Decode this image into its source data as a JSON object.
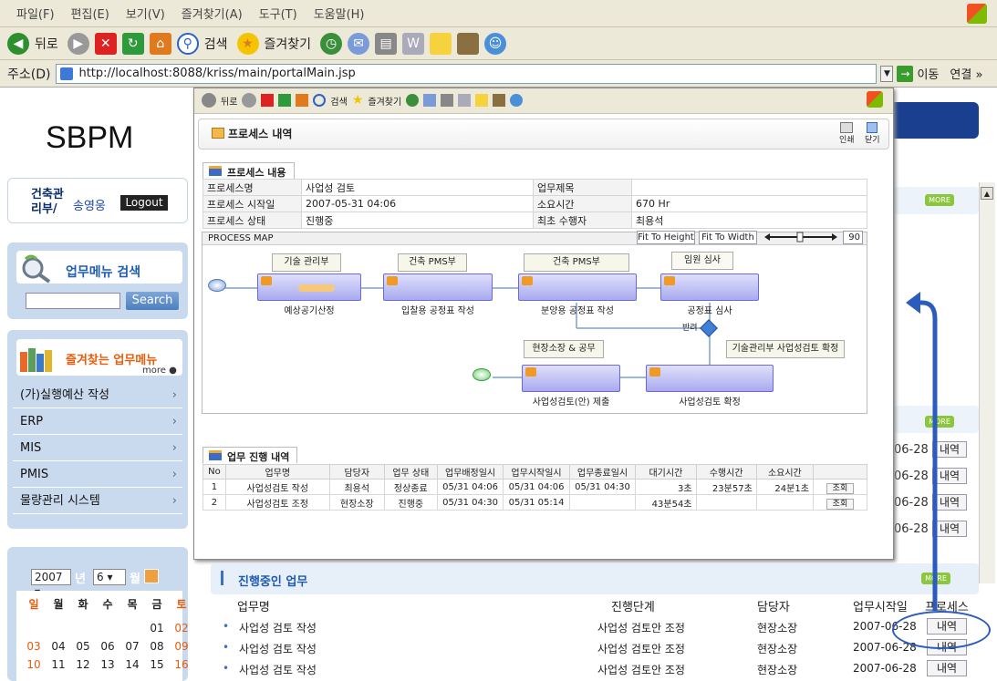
{
  "browser": {
    "menu": [
      "파일(F)",
      "편집(E)",
      "보기(V)",
      "즐겨찾기(A)",
      "도구(T)",
      "도움말(H)"
    ],
    "back_label": "뒤로",
    "search_label": "검색",
    "favorites_label": "즐겨찾기",
    "address_label": "주소(D)",
    "url": "http://localhost:8088/kriss/main/portalMain.jsp",
    "go_label": "이동",
    "links_label": "연결 »"
  },
  "portal": {
    "logo": "SBPM",
    "user_dept": "건축관리부/",
    "user_name": "송영웅",
    "logout_label": "Logout",
    "search_title": "업무메뉴 검색",
    "search_button": "Search",
    "fav_title": "즐겨찾는 업무메뉴",
    "fav_more": "more",
    "fav_items": [
      "(가)실행예산 작성",
      "ERP",
      "MIS",
      "PMIS",
      "물량관리 시스템"
    ],
    "calendar": {
      "year": "2007",
      "year_suffix": "년",
      "month": "6",
      "month_suffix": "월",
      "weekdays": [
        "일",
        "월",
        "화",
        "수",
        "목",
        "금",
        "토"
      ],
      "rows": [
        [
          "",
          "",
          "",
          "",
          "",
          "01",
          "02"
        ],
        [
          "03",
          "04",
          "05",
          "06",
          "07",
          "08",
          "09"
        ],
        [
          "10",
          "11",
          "12",
          "13",
          "14",
          "15",
          "16"
        ]
      ]
    },
    "more_badge": "MORE",
    "side_dates": [
      "06-28",
      "06-28",
      "06-28",
      "06-28"
    ],
    "detail_label": "내역",
    "ongoing": {
      "title": "진행중인 업무",
      "headers": [
        "업무명",
        "진행단계",
        "담당자",
        "업무시작일",
        "프로세스"
      ],
      "rows": [
        {
          "name": "사업성 검토 작성",
          "stage": "사업성 검토안 조정",
          "owner": "현장소장",
          "date": "2007-06-28",
          "btn": "내역"
        },
        {
          "name": "사업성 검토 작성",
          "stage": "사업성 검토안 조정",
          "owner": "현장소장",
          "date": "2007-06-28",
          "btn": "내역"
        },
        {
          "name": "사업성 검토 작성",
          "stage": "사업성 검토안 조정",
          "owner": "현장소장",
          "date": "2007-06-28",
          "btn": "내역"
        }
      ]
    }
  },
  "popup": {
    "toolbar": {
      "back": "뒤로",
      "search": "검색",
      "favorites": "즐겨찾기"
    },
    "title": "프로세스 내역",
    "print_label": "인쇄",
    "close_label": "닫기",
    "content_tab": "프로세스 내용",
    "info": {
      "process_name_label": "프로세스명",
      "process_name": "사업성 검토",
      "task_title_label": "업무제목",
      "task_title": "",
      "start_label": "프로세스 시작일",
      "start": "2007-05-31 04:06",
      "duration_label": "소요시간",
      "duration": "670 Hr",
      "status_label": "프로세스 상태",
      "status": "진행중",
      "last_actor_label": "최초 수행자",
      "last_actor": "최용석"
    },
    "map": {
      "label": "PROCESS MAP",
      "fit_height": "Fit To Height",
      "fit_width": "Fit To Width",
      "zoom": "90",
      "lanes": [
        "기술 관리부",
        "건축 PMS부",
        "건축 PMS부",
        "임원 심사",
        "현장소장 & 공무",
        "기술관리부 사업성검토 확정"
      ],
      "tasks": [
        "예상공기산정",
        "입찰용 공정표 작성",
        "분양용 공정표 작성",
        "공정표 심사",
        "사업성검토(안) 제출",
        "사업성검토 확정"
      ],
      "reject_label": "반려"
    },
    "progress_tab": "업무 진행 내역",
    "progress": {
      "headers": [
        "No",
        "업무명",
        "담당자",
        "업무 상태",
        "업무배정일시",
        "업무시작일시",
        "업무종료일시",
        "대기시간",
        "수행시간",
        "소요시간",
        ""
      ],
      "rows": [
        [
          "1",
          "사업성검토 작성",
          "최용석",
          "정상종료",
          "05/31 04:06",
          "05/31 04:06",
          "05/31 04:30",
          "3초",
          "23분57초",
          "24분1초",
          "조회"
        ],
        [
          "2",
          "사업성검토 조정",
          "현장소장",
          "진행중",
          "05/31 04:30",
          "05/31 05:14",
          "",
          "43분54초",
          "",
          "",
          "조회"
        ]
      ]
    }
  }
}
